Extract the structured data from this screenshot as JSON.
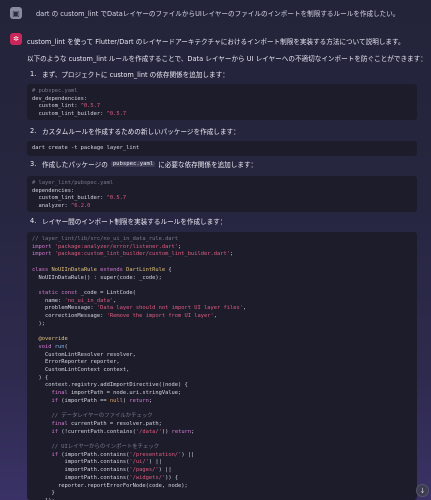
{
  "user_message": {
    "avatar": "▣",
    "text": "dart の custom_lint でDataレイヤーのファイルからUIレイヤーのファイルのインポートを制限するルールを作成したい。"
  },
  "assistant": {
    "avatar": "✲",
    "intro": "custom_lint を使って Flutter/Dart のレイヤードアーキテクチャにおけるインポート制限を実装する方法について説明します。",
    "intro2": "以下のような custom_lint ルールを作成することで、Data レイヤーから UI レイヤーへの不適切なインポートを防ぐことができます：",
    "steps": [
      {
        "num": "1.",
        "text": "まず、プロジェクトに custom_lint の依存関係を追加します："
      },
      {
        "num": "2.",
        "text": "カスタムルールを作成するための新しいパッケージを作成します："
      },
      {
        "num": "3.",
        "pre": "作成したパッケージの",
        "code": "pubspec.yaml",
        "post": "に必要な依存関係を追加します："
      },
      {
        "num": "4.",
        "text": "レイヤー間のインポート制限を実装するルールを作成します："
      }
    ],
    "code1": {
      "comment": "# pubspec.yaml",
      "l1": "dev_dependencies:",
      "l2k": "  custom_lint: ",
      "l2v": "^0.5.7",
      "l3k": "  custom_lint_builder: ",
      "l3v": "^0.5.7"
    },
    "code2": {
      "l1": "dart create -t package layer_lint"
    },
    "code3": {
      "comment": "# layer_lint/pubspec.yaml",
      "l1": "dependencies:",
      "l2k": "  custom_lint_builder: ",
      "l2v": "^0.5.7",
      "l3k": "  analyzer: ",
      "l3v": "^6.2.0"
    },
    "code4": {
      "c1": "// layer_lint/lib/src/no_ui_in_data_rule.dart",
      "imp1a": "import ",
      "imp1b": "'package:analyzer/error/listener.dart'",
      "imp1c": ";",
      "imp2a": "import ",
      "imp2b": "'package:custom_lint_builder/custom_lint_builder.dart'",
      "imp2c": ";",
      "cls_a": "class ",
      "cls_b": "NoUIInDataRule ",
      "cls_c": "extends ",
      "cls_d": "DartLintRule ",
      "cls_e": "{",
      "ctor": "  NoUIInDataRule() : super(code: _code);",
      "sc_a": "  static const ",
      "sc_b": "_code = LintCode(",
      "name_a": "    name: ",
      "name_b": "'no_ui_in_data'",
      "name_c": ",",
      "pm_a": "    problemMessage: ",
      "pm_b": "'Data layer should not import UI layer files'",
      "pm_c": ",",
      "cm_a": "    correctionMessage: ",
      "cm_b": "'Remove the import from UI layer'",
      "cm_c": ",",
      "close1": "  );",
      "ov": "  @override",
      "run_a": "  void ",
      "run_b": "run",
      "run_c": "(",
      "p1": "    CustomLintResolver resolver,",
      "p2": "    ErrorReporter reporter,",
      "p3": "    CustomLintContext context,",
      "p4": "  ) {",
      "reg": "    context.registry.addImportDirective((node) {",
      "fi_a": "      final ",
      "fi_b": "importPath = node.uri.stringValue;",
      "if1_a": "      if ",
      "if1_b": "(importPath == ",
      "if1_c": "null",
      "if1_d": ") ",
      "if1_e": "return",
      "if1_f": ";",
      "cm1": "      // データレイヤーのファイルかチェック",
      "fc_a": "      final ",
      "fc_b": "currentPath = resolver.path;",
      "if2_a": "      if ",
      "if2_b": "(!currentPath.contains(",
      "if2_c": "'/data/'",
      "if2_d": ")) ",
      "if2_e": "return",
      "if2_f": ";",
      "cm2": "      // UIレイヤーからのインポートをチェック",
      "if3_a": "      if ",
      "if3_b": "(importPath.contains(",
      "if3_c": "'/presentation/'",
      "if3_d": ") ||",
      "l4_a": "          importPath.contains(",
      "l4_b": "'/ui/'",
      "l4_c": ") ||",
      "l5_a": "          importPath.contains(",
      "l5_b": "'/pages/'",
      "l5_c": ") ||",
      "l6_a": "          importPath.contains(",
      "l6_b": "'/widgets/'",
      "l6_c": ")) {",
      "rep": "        reporter.reportErrorForNode(code, node);",
      "cl1": "      }",
      "cl2": "    });",
      "cl3": "  }"
    }
  },
  "scroll_button": {
    "icon": "↓"
  }
}
